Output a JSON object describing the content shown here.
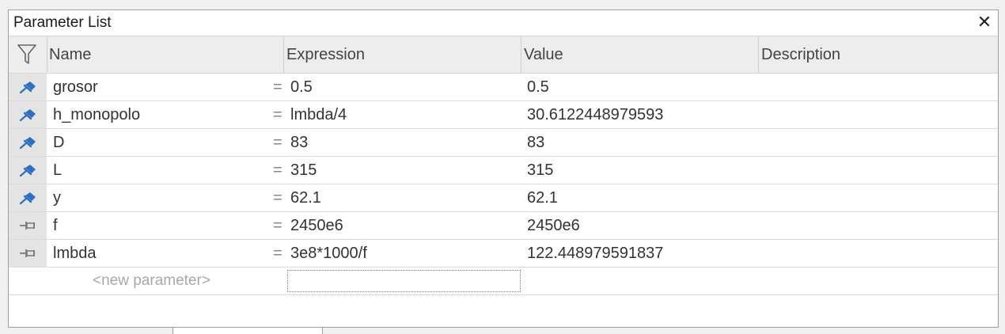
{
  "panel": {
    "title": "Parameter List",
    "close_glyph": "✕"
  },
  "columns": {
    "filter_icon": "filter-icon",
    "name": "Name",
    "expression": "Expression",
    "value": "Value",
    "description": "Description"
  },
  "parameters": [
    {
      "pinned": true,
      "name": "grosor",
      "eq": "=",
      "expression": "0.5",
      "value": "0.5",
      "description": ""
    },
    {
      "pinned": true,
      "name": "h_monopolo",
      "eq": "=",
      "expression": "lmbda/4",
      "value": "30.6122448979593",
      "description": ""
    },
    {
      "pinned": true,
      "name": "D",
      "eq": "=",
      "expression": "83",
      "value": "83",
      "description": ""
    },
    {
      "pinned": true,
      "name": "L",
      "eq": "=",
      "expression": "315",
      "value": "315",
      "description": ""
    },
    {
      "pinned": true,
      "name": "y",
      "eq": "=",
      "expression": "62.1",
      "value": "62.1",
      "description": ""
    },
    {
      "pinned": false,
      "name": "f",
      "eq": "=",
      "expression": "2450e6",
      "value": "2450e6",
      "description": ""
    },
    {
      "pinned": false,
      "name": "lmbda",
      "eq": "=",
      "expression": "3e8*1000/f",
      "value": "122.448979591837",
      "description": ""
    }
  ],
  "new_row": {
    "placeholder": "<new parameter>"
  },
  "colors": {
    "pin_active": "#2f6fbf",
    "pin_inactive": "#7a7a7a",
    "header_bg": "#ededed",
    "gutter_bg": "#e4e4e4"
  }
}
